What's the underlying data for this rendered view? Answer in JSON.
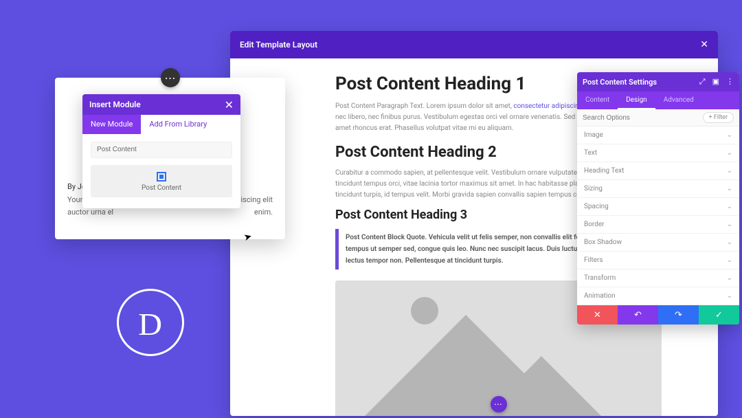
{
  "editor": {
    "title": "Edit Template Layout"
  },
  "post": {
    "h1": "Post Content Heading 1",
    "p1": "Post Content Paragraph Text. Lorem ipsum dolor sit amet, consectetur adipiscing elit. Ut vitae sagittis diam, nec finibus leo. Nulla ut libero, nec finibus purus. Vestibulum egestas orci vel ornare venenatis. Sed et ultricies turpis. Donec nec finibus libero. Donec sit amet rhoncus erat. Phasellus volutpat vitae mi eu aliquam.",
    "link1": "consectetur adipiscing elit",
    "h2": "Post Content Heading 2",
    "p2": "Curabitur a commodo sapien, at pellentesque velit. Vestibulum ornare vulputate. Mauris tempor magna at tincidunt tempus orci, vitae lacinia tortor maximus sit amet. In hac habitasse platea dictumst. Praesent id tincidunt turpis, id tempus velit. Morbi gravida sapien convallis sapien tempus consequat.",
    "h3": "Post Content Heading 3",
    "quote": "Post Content Block Quote. Vehicula velit ut felis semper, non convallis elit fermentum. Sed sapien nisl, tempus ut semper sed, congue quis leo. Nunc nec suscipit lacus. Duis luctus eros dui, nec finibus lectus tempor non. Pellentesque at tincidunt turpis."
  },
  "settings": {
    "title": "Post Content Settings",
    "search_placeholder": "Search Options",
    "filter_label": "Filter",
    "tabs": {
      "t0": "Content",
      "t1": "Design",
      "t2": "Advanced"
    },
    "rows": {
      "r0": "Image",
      "r1": "Text",
      "r2": "Heading Text",
      "r3": "Sizing",
      "r4": "Spacing",
      "r5": "Border",
      "r6": "Box Shadow",
      "r7": "Filters",
      "r8": "Transform",
      "r9": "Animation"
    }
  },
  "insert": {
    "title": "Insert Module",
    "tabs": {
      "t0": "New Module",
      "t1": "Add From Library"
    },
    "search_value": "Post Content",
    "module_label": "Post Content"
  },
  "card": {
    "byline": "By John Doe",
    "dyn_text_left": "Your dynamic",
    "dyn_text_right": "etur adipiscing elit",
    "dyn_text_line2_left": "auctor urna el",
    "dyn_text_line2_right": "enim."
  },
  "logo": {
    "letter": "D"
  }
}
